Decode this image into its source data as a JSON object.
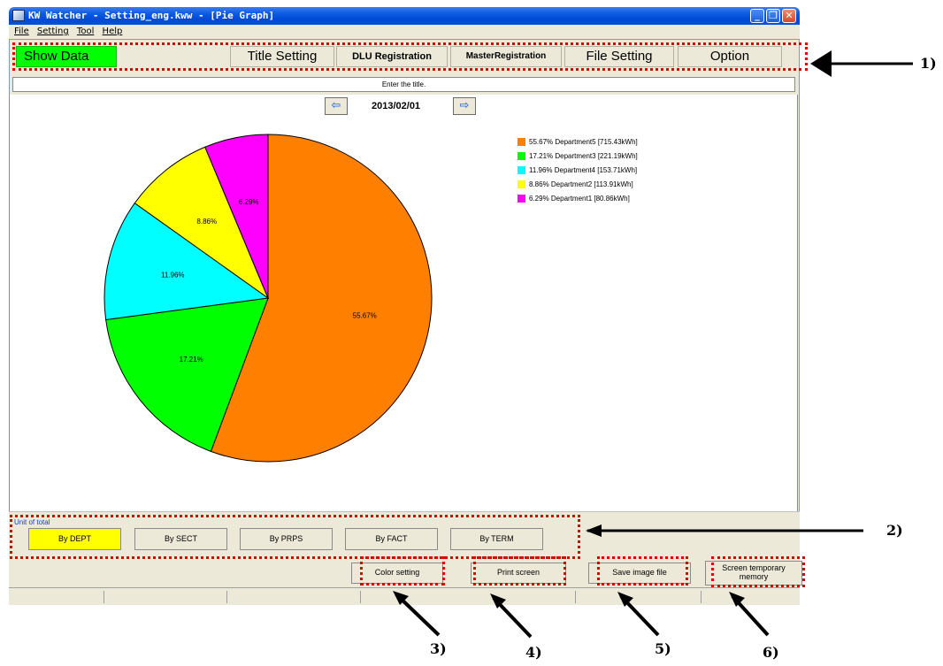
{
  "window": {
    "title": "KW Watcher - Setting_eng.kww - [Pie Graph]",
    "minimize_glyph": "_",
    "restore_glyph": "❐",
    "close_glyph": "✕"
  },
  "menu": [
    "File",
    "Setting",
    "Tool",
    "Help"
  ],
  "toolbar": {
    "show_data": "Show Data",
    "title_setting": "Title Setting",
    "dlu_registration": "DLU Registration",
    "master_registration": "MasterRegistration",
    "file_setting": "File Setting",
    "option": "Option"
  },
  "title_input": {
    "value": "Enter the title."
  },
  "date_nav": {
    "date": "2013/02/01",
    "prev_icon": "arrow-left-icon",
    "next_icon": "arrow-right-icon"
  },
  "chart_data": {
    "type": "pie",
    "slices": [
      {
        "label": "Department5",
        "percent": 55.67,
        "value": 715.43,
        "unit": "kWh",
        "color": "#ff8000",
        "legend": "55.67% Department5 [715.43kWh]",
        "slice_label": "55.67%"
      },
      {
        "label": "Department3",
        "percent": 17.21,
        "value": 221.19,
        "unit": "kWh",
        "color": "#00ff00",
        "legend": "17.21% Department3 [221.19kWh]",
        "slice_label": "17.21%"
      },
      {
        "label": "Department4",
        "percent": 11.96,
        "value": 153.71,
        "unit": "kWh",
        "color": "#00ffff",
        "legend": "11.96% Department4 [153.71kWh]",
        "slice_label": "11.96%"
      },
      {
        "label": "Department2",
        "percent": 8.86,
        "value": 113.91,
        "unit": "kWh",
        "color": "#ffff00",
        "legend": "8.86% Department2 [113.91kWh]",
        "slice_label": "8.86%"
      },
      {
        "label": "Department1",
        "percent": 6.29,
        "value": 80.86,
        "unit": "kWh",
        "color": "#ff00ff",
        "legend": "6.29% Department1 [80.86kWh]",
        "slice_label": "6.29%"
      }
    ],
    "legend_position": "top-right"
  },
  "unit_of_total": {
    "label": "Unit of total",
    "buttons": [
      "By DEPT",
      "By SECT",
      "By PRPS",
      "By FACT",
      "By TERM"
    ],
    "selected": "By DEPT"
  },
  "actions": {
    "color_setting": "Color setting",
    "print_screen": "Print screen",
    "save_image_file": "Save image file",
    "screen_temporary_memory_line1": "Screen temporary",
    "screen_temporary_memory_line2": "memory"
  },
  "annotations": [
    "1)",
    "2)",
    "3)",
    "4)",
    "5)",
    "6)"
  ],
  "colors": {
    "highlight": "#e00000",
    "show_data_bg": "#00ff00",
    "selected_unit_bg": "#ffff00"
  }
}
